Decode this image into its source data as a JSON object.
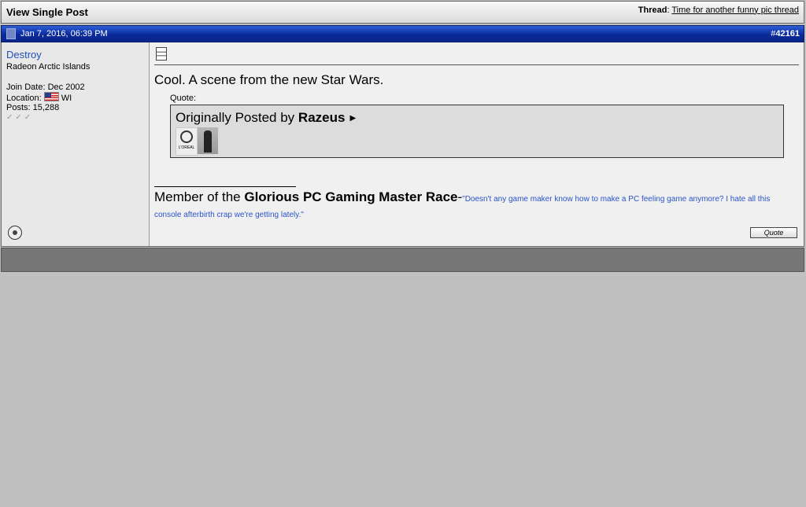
{
  "header": {
    "title": "View Single Post",
    "thread_label": "Thread",
    "thread_title": "Time for another funny pic thread"
  },
  "post": {
    "date": "Jan 7, 2016, 06:39 PM",
    "number_prefix": "#",
    "number": "42161",
    "message": "Cool. A scene from the new Star Wars.",
    "quote_label": "Quote:",
    "quote_prefix": "Originally Posted by",
    "quote_author": "Razeus",
    "quote_thumb_text": "L'OREAL",
    "quote_button": "Quote"
  },
  "user": {
    "name": "Destroy",
    "title": "Radeon Arctic Islands",
    "join_date": "Join Date: Dec 2002",
    "location_label": "Location:",
    "location": "WI",
    "posts": "Posts: 15,288"
  },
  "signature": {
    "prefix": "Member of the",
    "bold": "Glorious PC Gaming Master Race",
    "dash": "-",
    "quote": "\"Doesn't any game maker know how to make a PC feeling game anymore? I hate all this console afterbirth crap we're getting lately.\""
  },
  "colors": {
    "post_bar": "#0a2a9a",
    "username": "#2250b8",
    "signature_quote": "#2a55c8",
    "page_bg": "#c0c0c0"
  },
  "icons": {
    "post": "post-icon",
    "message": "message-icon",
    "status": "offline-status-icon",
    "flag": "us-flag-icon",
    "reputation": "reputation-icon"
  }
}
